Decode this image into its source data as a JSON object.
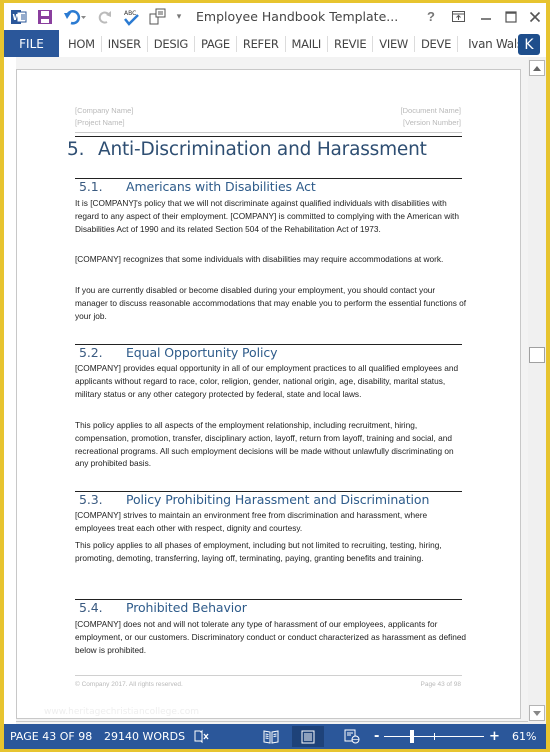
{
  "titlebar": {
    "doc_title": "Employee Handbook Template...",
    "help_label": "?",
    "icons": [
      "word-app-icon",
      "save-icon",
      "undo-icon",
      "redo-icon",
      "spelling-check-icon",
      "touch-mode-icon",
      "customize-toolbar-icon"
    ]
  },
  "ribbon": {
    "file_label": "FILE",
    "tabs": [
      "HOM",
      "INSER",
      "DESIG",
      "PAGE",
      "REFER",
      "MAILI",
      "REVIE",
      "VIEW",
      "DEVE"
    ],
    "user_name": "Ivan Walsh",
    "user_initial": "K"
  },
  "colors": {
    "accent": "#2b579a",
    "heading": "#2e4e72",
    "window_border": "#e7c42f"
  },
  "page": {
    "header": {
      "company_name": "[Company Name]",
      "project_name": "[Project Name]",
      "document_name": "[Document Name]",
      "version_number": "[Version Number]"
    },
    "h1": {
      "num": "5.",
      "title": "Anti-Discrimination and Harassment"
    },
    "sections": [
      {
        "num": "5.1.",
        "title": "Americans with Disabilities Act",
        "paragraphs": [
          "It is [COMPANY]'s policy that we will not discriminate against qualified individuals with disabilities with regard to any aspect of their employment. [COMPANY] is committed to complying with the American with Disabilities Act of 1990 and its related Section 504 of the Rehabilitation Act of 1973.",
          "[COMPANY] recognizes that some individuals with disabilities may require accommodations at work.",
          "If you are currently disabled or become disabled during your employment, you should contact your manager to discuss reasonable accommodations that may enable you to perform the essential functions of your job."
        ]
      },
      {
        "num": "5.2.",
        "title": "Equal Opportunity Policy",
        "paragraphs": [
          "[COMPANY] provides equal opportunity in all of our employment practices to all qualified employees and applicants without regard to race, color, religion, gender, national origin, age, disability, marital status, military status or any other category protected by federal, state and local laws.",
          "This policy applies to all aspects of the employment relationship, including recruitment, hiring, compensation, promotion, transfer, disciplinary action, layoff, return from layoff, training and social, and recreational programs. All such employment decisions will be made without unlawfully discriminating on any prohibited basis."
        ]
      },
      {
        "num": "5.3.",
        "title": "Policy Prohibiting Harassment and Discrimination",
        "paragraphs": [
          "[COMPANY] strives to maintain an environment free from discrimination and harassment, where employees treat each other with respect, dignity and courtesy.",
          "This policy applies to all phases of employment, including but not limited to recruiting, testing, hiring, promoting, demoting, transferring, laying off, terminating, paying, granting benefits and training."
        ]
      },
      {
        "num": "5.4.",
        "title": "Prohibited Behavior",
        "paragraphs": [
          "[COMPANY] does not and will not tolerate any type of harassment of our employees, applicants for employment, or our customers. Discriminatory conduct or conduct characterized as harassment as defined below is prohibited."
        ]
      }
    ],
    "footer": {
      "copyright": "© Company 2017. All rights reserved.",
      "page_label": "Page 43 of 98"
    },
    "watermark": "www.heritagechristiancollege.com"
  },
  "statusbar": {
    "page_info": "PAGE 43 OF 98",
    "word_count": "29140 WORDS",
    "zoom_minus": "-",
    "zoom_plus": "+",
    "zoom_level": "61%",
    "zoom_percent": 61
  }
}
